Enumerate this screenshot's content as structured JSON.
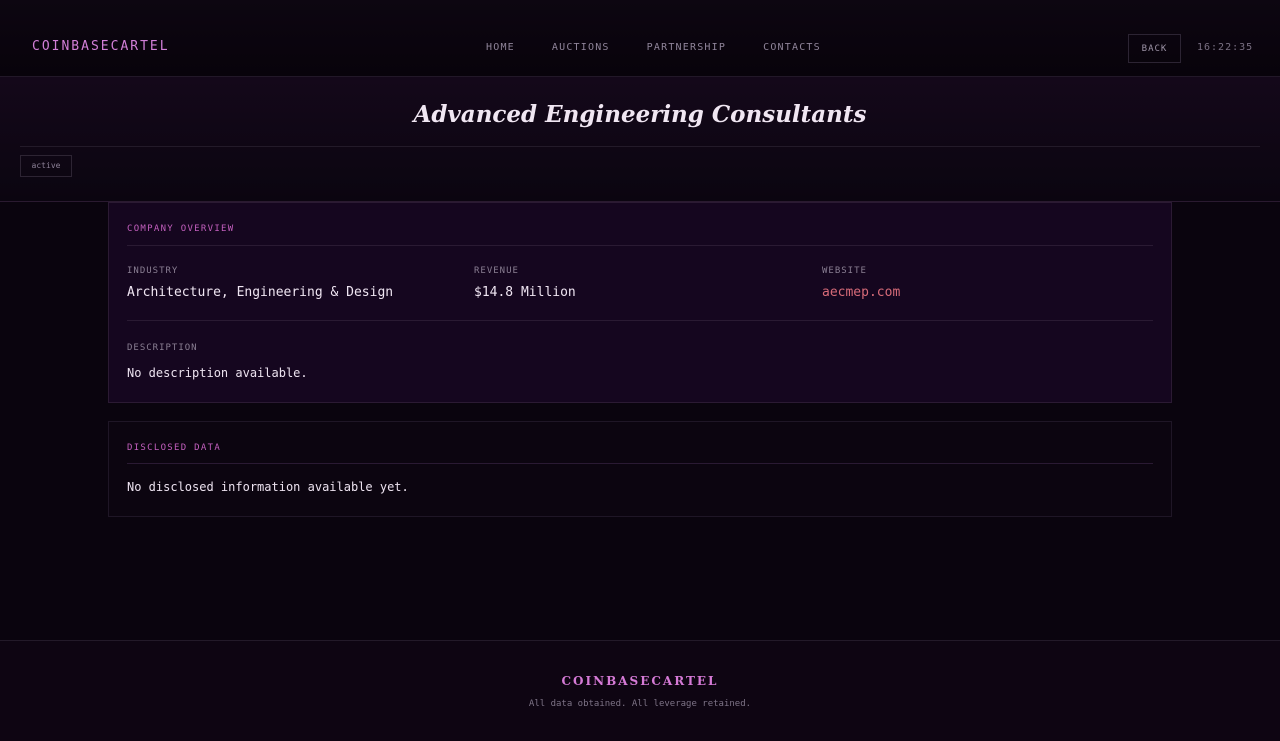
{
  "header": {
    "brand": "COINBASECARTEL",
    "nav": [
      "HOME",
      "AUCTIONS",
      "PARTNERSHIP",
      "CONTACTS"
    ],
    "back_label": "BACK",
    "clock": "16:22:35"
  },
  "company": {
    "name": "Advanced Engineering Consultants",
    "status": "active"
  },
  "overview": {
    "title": "COMPANY OVERVIEW",
    "industry_label": "INDUSTRY",
    "industry": "Architecture, Engineering & Design",
    "revenue_label": "REVENUE",
    "revenue": "$14.8 Million",
    "website_label": "WEBSITE",
    "website": "aecmep.com",
    "description_label": "DESCRIPTION",
    "description": "No description available."
  },
  "disclosed": {
    "title": "DISCLOSED DATA",
    "text": "No disclosed information available yet."
  },
  "footer": {
    "brand": "COINBASECARTEL",
    "note": "All data obtained. All leverage retained."
  },
  "colors": {
    "accent": "#d27fd8",
    "link": "#d66a78",
    "background": "#0a040e",
    "card": "#15061f"
  }
}
